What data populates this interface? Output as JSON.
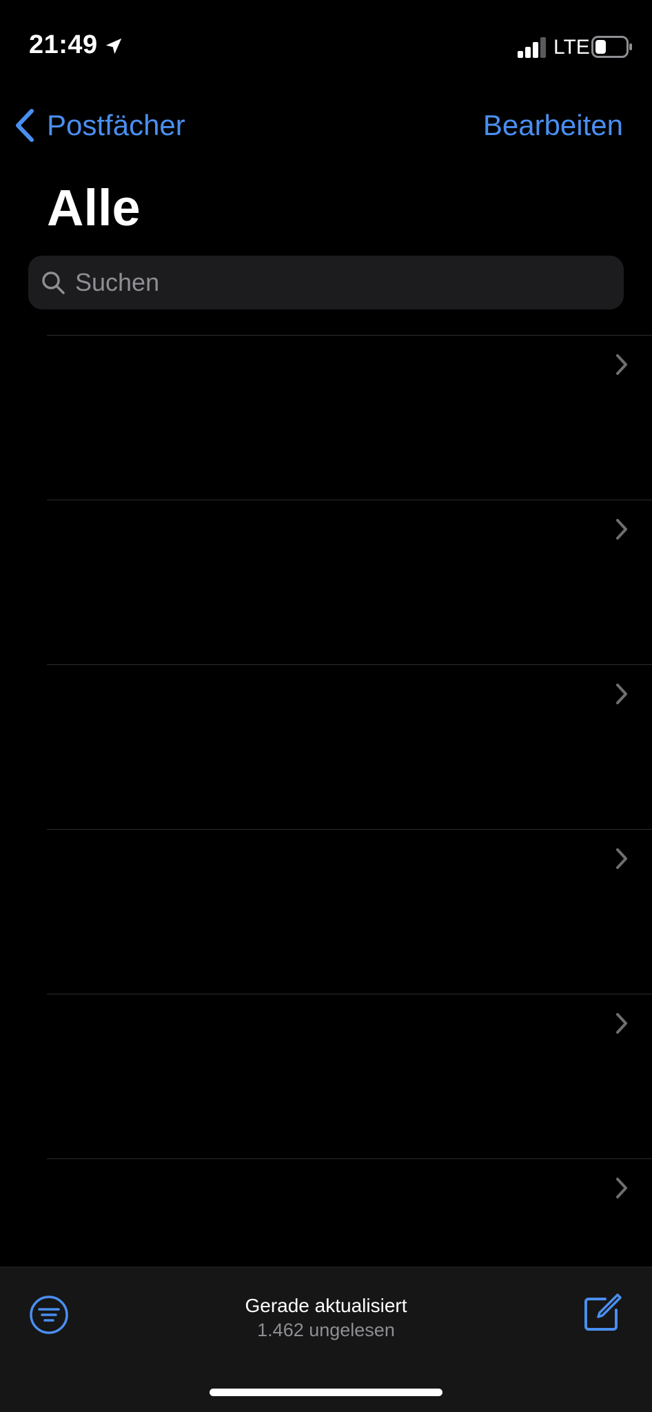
{
  "status_bar": {
    "time": "21:49",
    "network": "LTE",
    "signal_bars": 3,
    "battery_level": 0.3
  },
  "nav": {
    "back_label": "Postfächer",
    "edit_label": "Bearbeiten"
  },
  "title": "Alle",
  "search": {
    "placeholder": "Suchen"
  },
  "list": {
    "row_count": 6
  },
  "toolbar": {
    "status_line1": "Gerade aktualisiert",
    "status_line2": "1.462 ungelesen"
  },
  "colors": {
    "accent": "#4a8ff0",
    "background": "#000000",
    "search_bg": "#1c1c1e",
    "secondary_text": "#8e8e93"
  },
  "icons": {
    "back": "chevron-left-icon",
    "search": "search-icon",
    "row": "chevron-right-icon",
    "filter": "filter-icon",
    "compose": "compose-icon",
    "location": "location-arrow-icon",
    "signal": "signal-icon",
    "battery": "battery-icon"
  }
}
